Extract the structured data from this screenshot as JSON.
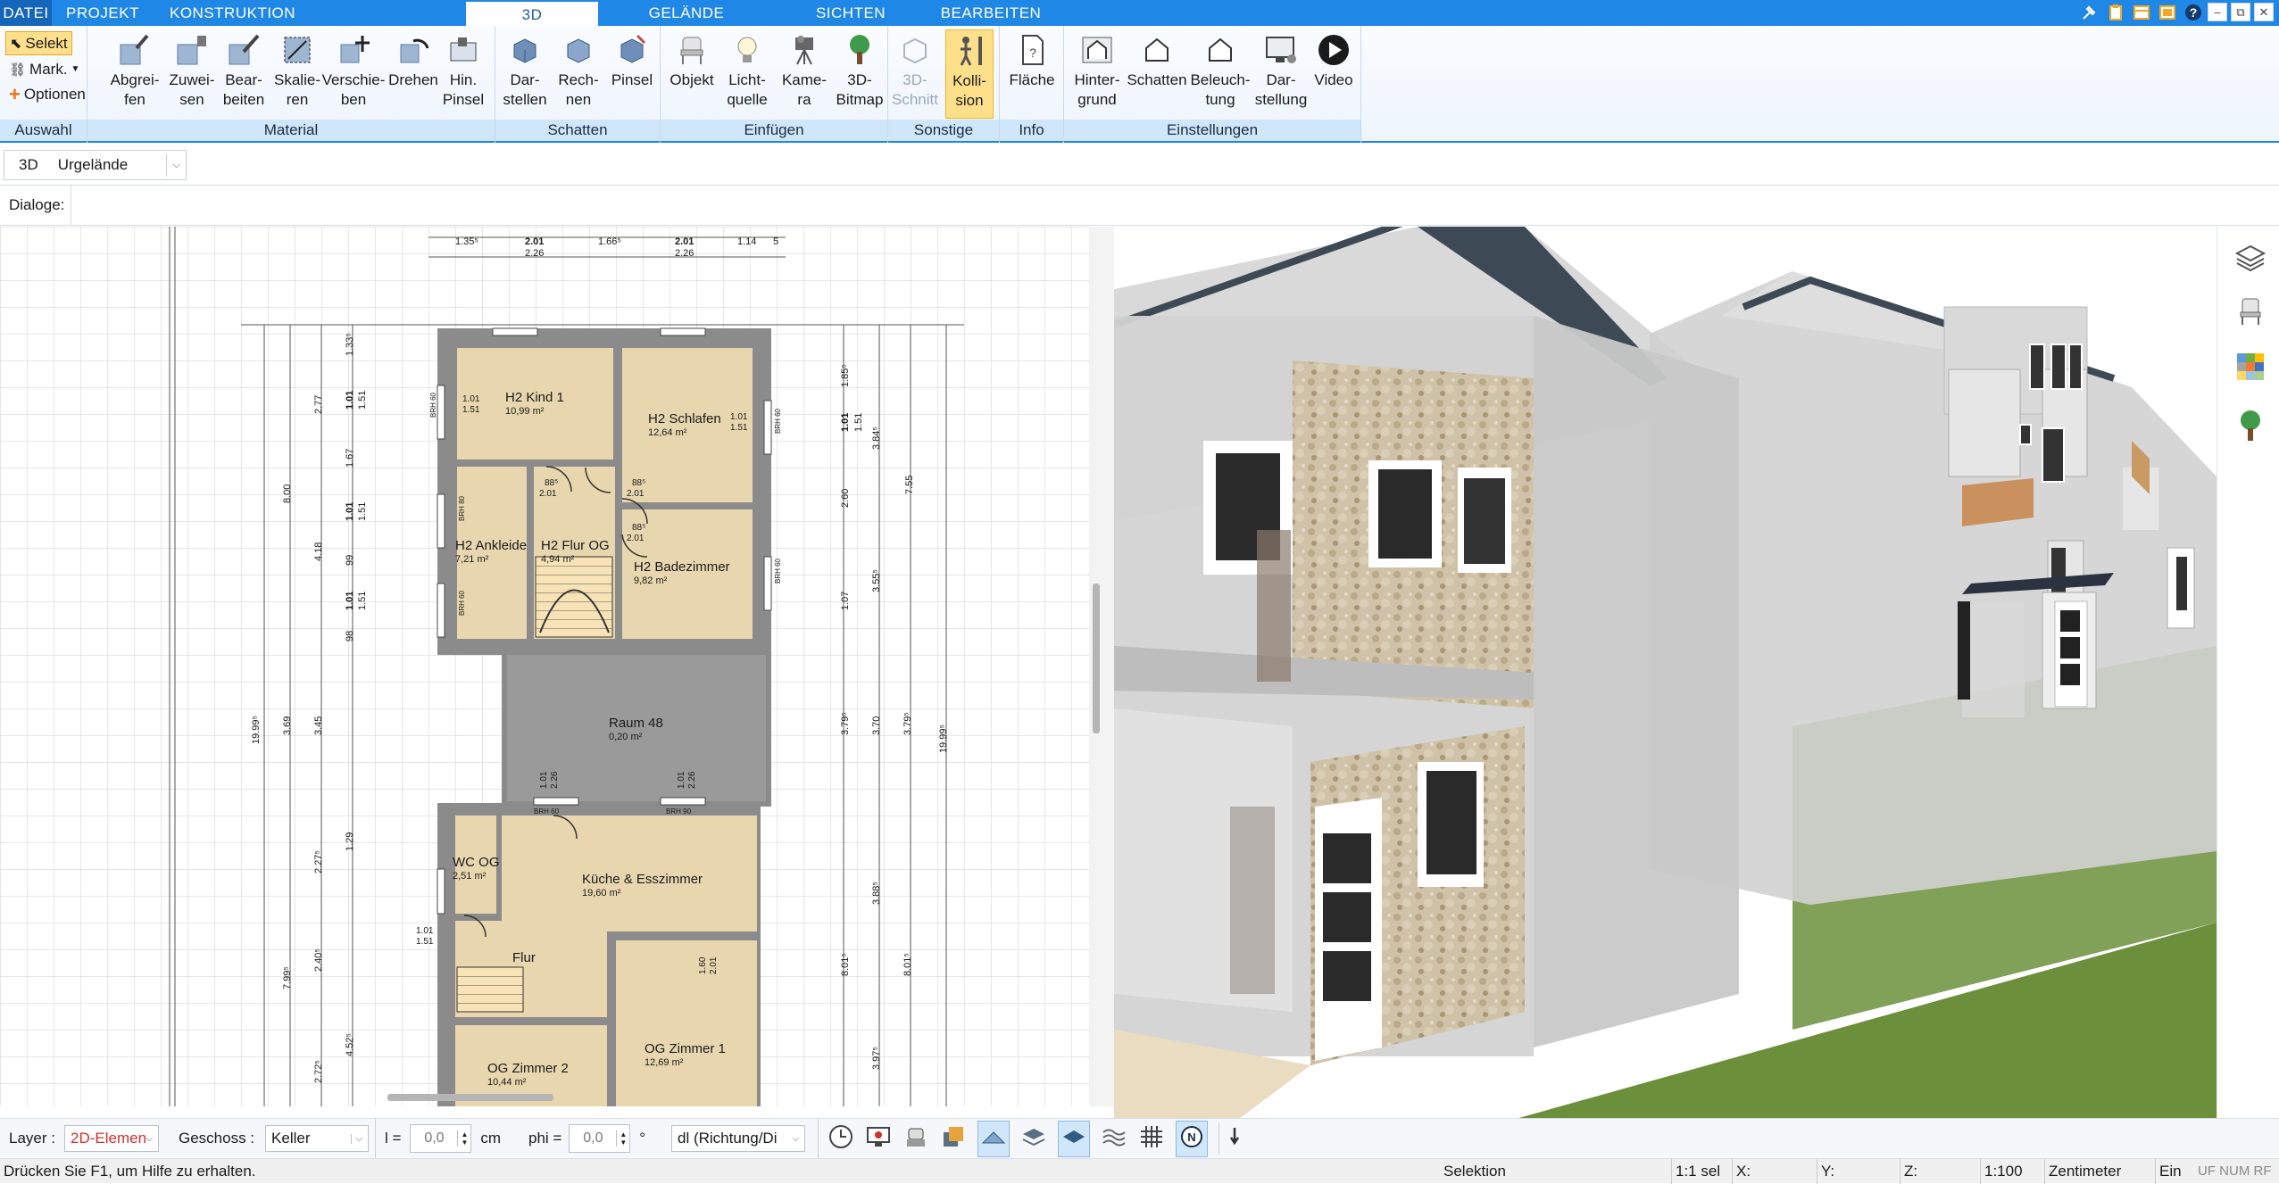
{
  "menu": {
    "tabs": [
      {
        "label": "DATEI"
      },
      {
        "label": "PROJEKT"
      },
      {
        "label": "KONSTRUKTION"
      },
      {
        "label": "3D"
      },
      {
        "label": "GELÄNDE"
      },
      {
        "label": "SICHTEN"
      },
      {
        "label": "BEARBEITEN"
      }
    ],
    "active_tab": "3D"
  },
  "window_controls": {
    "minimize": "–",
    "restore": "⧉",
    "close": "✕"
  },
  "ribbon": {
    "auswahl": {
      "group_label": "Auswahl",
      "select": "Selekt",
      "mark": "Mark.",
      "options": "Optionen"
    },
    "material": {
      "group_label": "Material",
      "buttons": [
        "Abgrei-\nfen",
        "Zuwei-\nsen",
        "Bear-\nbeiten",
        "Skalie-\nren",
        "Verschie-\nben",
        "Drehen",
        "Hin.\nPinsel"
      ]
    },
    "schatten": {
      "group_label": "Schatten",
      "buttons": [
        "Dar-\nstellen",
        "Rech-\nnen",
        "Pinsel"
      ]
    },
    "einfuegen": {
      "group_label": "Einfügen",
      "buttons": [
        "Objekt",
        "Licht-\nquelle",
        "Kame-\nra",
        "3D-\nBitmap"
      ]
    },
    "sonstige": {
      "group_label": "Sonstige",
      "buttons": [
        "3D-\nSchnitt",
        "Kolli-\nsion"
      ]
    },
    "info": {
      "group_label": "Info",
      "buttons": [
        "Fläche"
      ]
    },
    "einstellungen": {
      "group_label": "Einstellungen",
      "buttons": [
        "Hinter-\ngrund",
        "Schatten",
        "Beleuch-\ntung",
        "Dar-\nstellung",
        "Video"
      ]
    }
  },
  "toolbar": {
    "mode_label": "3D",
    "terrain_select": "Urgelände",
    "dialogs_label": "Dialoge:"
  },
  "plan": {
    "rooms": [
      {
        "name": "H2 Kind 1",
        "area": "10,99 m²"
      },
      {
        "name": "H2 Schlafen",
        "area": "12,64 m²"
      },
      {
        "name": "H2 Ankleide",
        "area": "7,21 m²"
      },
      {
        "name": "H2 Flur OG",
        "area": "4,94 m²"
      },
      {
        "name": "H2 Badezimmer",
        "area": "9,82 m²"
      },
      {
        "name": "Raum 48",
        "area": "0,20 m²"
      },
      {
        "name": "WC OG",
        "area": "2,51 m²"
      },
      {
        "name": "Küche & Esszimmer",
        "area": "19,60 m²"
      },
      {
        "name": "Flur",
        "area": ""
      },
      {
        "name": "OG Zimmer 2",
        "area": "10,44 m²"
      },
      {
        "name": "OG Zimmer 1",
        "area": "12,69 m²"
      }
    ],
    "dims_top": [
      "1.35⁵",
      "2.01",
      "2.26",
      "1.66⁵",
      "2.01",
      "2.26",
      "1.14",
      "5"
    ],
    "dims_left": [
      "1.33⁵",
      "2.77",
      "1.01",
      "1.51",
      "1.67",
      "8.00",
      "1.01",
      "1.51",
      "4.18",
      "99",
      "1.01",
      "1.51",
      "98",
      "19.99⁵",
      "3.69",
      "3.45",
      "2.27⁵",
      "1.29",
      "7.99⁵",
      "2.40⁵",
      "4.52⁵",
      "2.72⁵"
    ],
    "dims_right": [
      "1.85⁵",
      "3.84⁵",
      "1.51",
      "1.01",
      "2.60",
      "7.55",
      "3.55⁵",
      "1.07",
      "3.79⁵",
      "3.70",
      "3.79⁵",
      "19.99⁵",
      "3.88⁵",
      "8.01⁵",
      "8.01⁵",
      "3.97⁵"
    ],
    "door_dims": [
      "88⁵",
      "2.01",
      "88⁵",
      "2.01",
      "88⁵",
      "2.01",
      "1.01",
      "1.51",
      "1.01",
      "1.51",
      "1.01",
      "2.26",
      "1.01",
      "2.26",
      "1.01",
      "1.51",
      "1.60",
      "2.01"
    ],
    "brh_labels": [
      "BRH 60",
      "BRH 80",
      "BRH 60",
      "BRH 60",
      "BRH 60",
      "BRH 60",
      "BRH 90"
    ]
  },
  "bottom": {
    "layer_label": "Layer :",
    "layer_value": "2D-Elemen",
    "floor_label": "Geschoss :",
    "floor_value": "Keller",
    "l_label": "l =",
    "l_value": "0,0",
    "l_unit": "cm",
    "phi_label": "phi =",
    "phi_value": "0,0",
    "phi_unit": "°",
    "direction_value": "dl (Richtung/Di"
  },
  "status": {
    "help": "Drücken Sie F1, um Hilfe zu erhalten.",
    "mode": "Selektion",
    "sel": "1:1 sel",
    "x": "X:",
    "y": "Y:",
    "z": "Z:",
    "scale": "1:100",
    "unit": "Zentimeter",
    "on": "Ein",
    "flags": "UF NUM RF"
  },
  "colors": {
    "accent": "#1f87e6",
    "active_tool": "#ffe08a",
    "room_floor": "#e8d7ae",
    "wall": "#8b8b8b",
    "grass": "#6b8f3b"
  }
}
